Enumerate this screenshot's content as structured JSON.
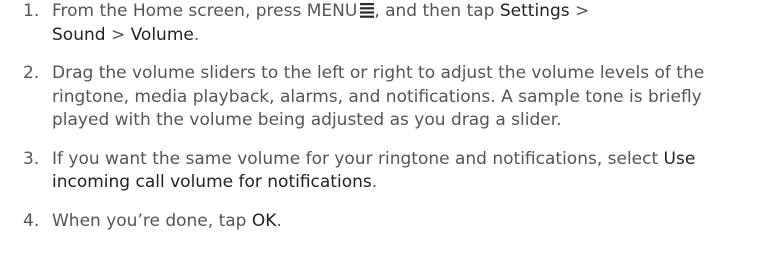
{
  "steps": [
    {
      "number": "1.",
      "t1": "From the Home screen, press MENU",
      "t2": ", and then tap ",
      "settings": "Settings",
      "sep1": " > ",
      "sound": "Sound",
      "sep2": " > ",
      "volume": "Volume",
      "t3": ".",
      "icon": "menu-icon"
    },
    {
      "number": "2.",
      "text": "Drag the volume sliders to the left or right to adjust the volume levels of the ringtone, media playback, alarms, and notifications. A sample tone is briefly played with the volume being adjusted as you drag a slider."
    },
    {
      "number": "3.",
      "t1": "If you want the same volume for your ringtone and notifications, select ",
      "option": "Use incoming call volume for notifications",
      "t2": "."
    },
    {
      "number": "4.",
      "t1": "When you’re done, tap ",
      "ok": "OK",
      "t2": "."
    }
  ],
  "colors": {
    "body_text": "#555555",
    "emphasis_text": "#222222"
  }
}
